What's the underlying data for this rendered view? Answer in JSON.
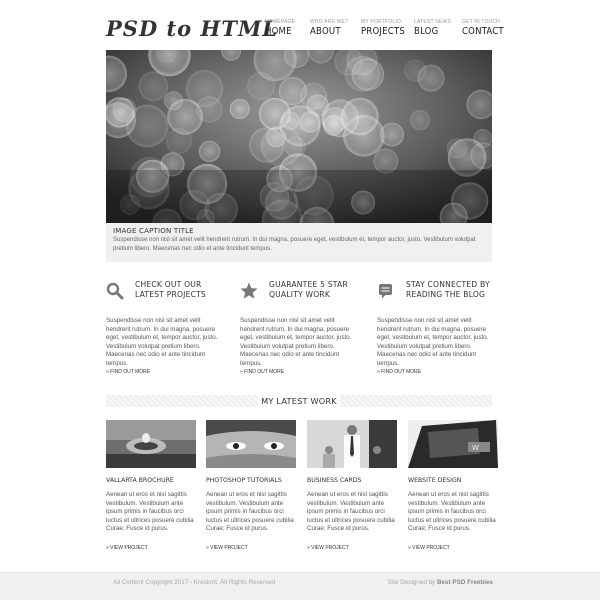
{
  "header": {
    "logo": "PSD to HTML",
    "nav": [
      {
        "sub": "HOMEPAGE",
        "label": "HOME"
      },
      {
        "sub": "WHO ARE WE?",
        "label": "ABOUT"
      },
      {
        "sub": "MY PORTFOLIO",
        "label": "PROJECTS"
      },
      {
        "sub": "LATEST NEWS",
        "label": "BLOG"
      },
      {
        "sub": "GET IN TOUCH",
        "label": "CONTACT"
      }
    ]
  },
  "hero": {
    "caption_title": "IMAGE CAPTION TITLE",
    "caption_text": "Suspendisse non nisl sit amet velit hendrerit rutrum. In dui magna, posuere eget,  vestibulum et, tempor auctor, justo. Vestibulum volutpat pretium libero. Maecenas nec odio et ante tincidunt tempus."
  },
  "features": [
    {
      "icon": "search-icon",
      "title": "CHECK OUT OUR LATEST PROJECTS",
      "text": "Suspendisse non nisl sit amet velit hendrerit rutrum. In dui magna, posuere eget, vestibulum et, tempor auctor, justo. Vestibulum volutpat pretium libero. Maecenas nec odio et ante tincidunt tempus.",
      "more": "» FIND OUT MORE"
    },
    {
      "icon": "star-icon",
      "title": "GUARANTEE 5 STAR QUALITY  WORK",
      "text": "Suspendisse non nisl sit amet velit hendrerit rutrum. In dui magna, posuere eget, vestibulum et, tempor auctor, justo. Vestibulum volutpat pretium libero. Maecenas nec odio et ante tincidunt tempus.",
      "more": "» FIND OUT MORE"
    },
    {
      "icon": "speech-bubble-icon",
      "title": "STAY CONNECTED BY READING THE BLOG",
      "text": "Suspendisse non nisl sit amet velit hendrerit rutrum. In dui magna, posuere eget, vestibulum et, tempor auctor, justo. Vestibulum volutpat pretium libero. Maecenas nec odio et ante tincidunt tempus.",
      "more": "» FIND OUT MORE"
    }
  ],
  "latest_work": {
    "heading": "MY LATEST WORK",
    "items": [
      {
        "title": "VALLARTA BROCHURE",
        "text": "Aenean ut eros et nisl sagittis vestibulum. Vestibulum ante ipsum primis in faucibus orci luctus et ultrices posuere cubilia Curae; Fusce id purus.",
        "more": "» VIEW PROJECT"
      },
      {
        "title": "PHOTOSHOP TUTORIALS",
        "text": "Aenean ut eros et nisl sagittis vestibulum. Vestibulum ante ipsum primis in faucibus orci luctus et ultrices posuere cubilia Curae; Fusce id purus.",
        "more": "» VIEW PROJECT"
      },
      {
        "title": "BUSINESS CARDS",
        "text": "Aenean ut eros et nisl sagittis vestibulum. Vestibulum ante ipsum primis in faucibus orci luctus et ultrices posuere cubilia Curae; Fusce id purus.",
        "more": "» VIEW PROJECT"
      },
      {
        "title": "WEBSITE DESIGN",
        "text": "Aenean ut eros et nisl sagittis vestibulum. Vestibulum ante ipsum primis in faucibus orci luctus et ultrices posuere cubilia Curae; Fusce id purus.",
        "more": "» VIEW PROJECT"
      }
    ]
  },
  "footer": {
    "copyright": "All Content Copyright 2017 - Kreslont. All Rights Reserved",
    "credit_prefix": "Site Designed by ",
    "credit_link": "Best PSD Freebies"
  }
}
